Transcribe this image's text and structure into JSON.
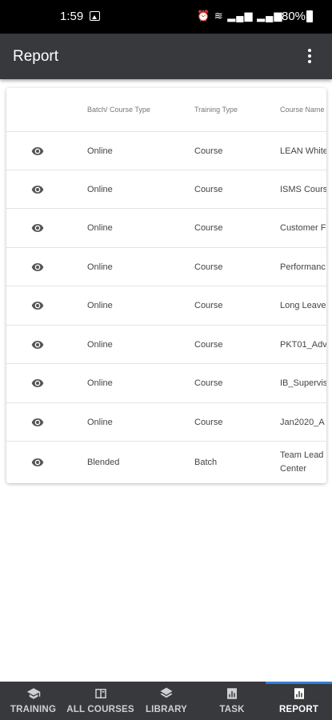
{
  "status_bar": {
    "time": "1:59",
    "icons_text": "⏰ ≋ ▂▄▆ ▂▄▆",
    "battery": "80%"
  },
  "app_bar": {
    "title": "Report",
    "menu_icon": "more-vertical-icon"
  },
  "table": {
    "headers": {
      "batch": "Batch/ Course Type",
      "training_type": "Training Type",
      "course_name": "Course Name"
    },
    "view_icon": "eye-icon",
    "rows": [
      {
        "batch": "Online",
        "training_type": "Course",
        "course_name": "LEAN White"
      },
      {
        "batch": "Online",
        "training_type": "Course",
        "course_name": "ISMS Cours"
      },
      {
        "batch": "Online",
        "training_type": "Course",
        "course_name": "Customer F"
      },
      {
        "batch": "Online",
        "training_type": "Course",
        "course_name": "Performanc"
      },
      {
        "batch": "Online",
        "training_type": "Course",
        "course_name": "Long Leave"
      },
      {
        "batch": "Online",
        "training_type": "Course",
        "course_name": "PKT01_Adv"
      },
      {
        "batch": "Online",
        "training_type": "Course",
        "course_name": "IB_Supervis"
      },
      {
        "batch": "Online",
        "training_type": "Course",
        "course_name": "Jan2020_A"
      },
      {
        "batch": "Blended",
        "training_type": "Batch",
        "course_name": "Team Lead Center"
      }
    ]
  },
  "bottom_nav": {
    "active": "report",
    "active_color": "#2f7fd6",
    "items": [
      {
        "label": "TRAINING",
        "icon": "graduation-cap-icon"
      },
      {
        "label": "ALL COURSES",
        "icon": "course-book-icon"
      },
      {
        "label": "LIBRARY",
        "icon": "layers-icon"
      },
      {
        "label": "TASK",
        "icon": "task-chart-icon"
      },
      {
        "label": "REPORT",
        "icon": "report-chart-icon"
      }
    ]
  }
}
